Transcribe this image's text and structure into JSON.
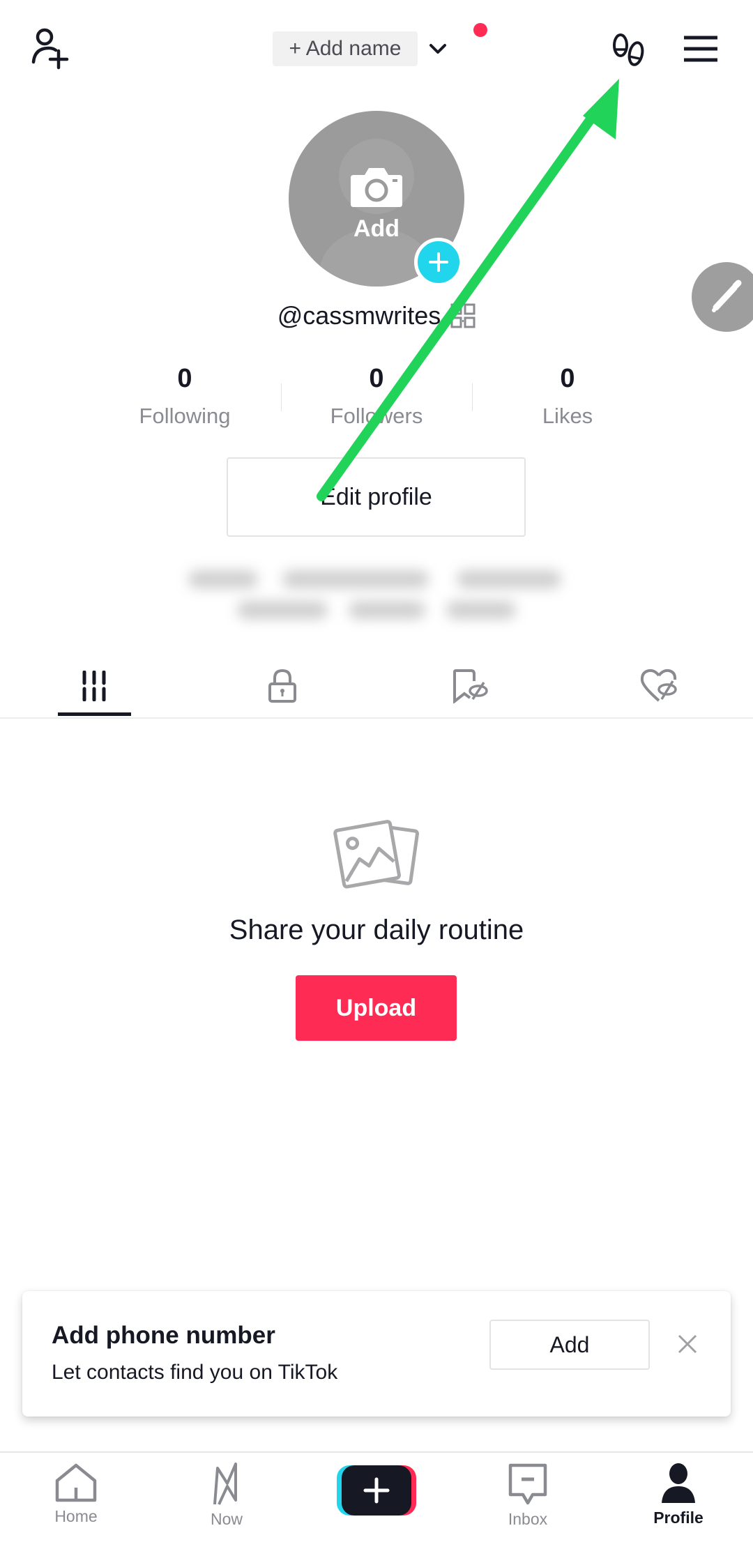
{
  "header": {
    "add_user_icon": "person-add-icon",
    "name_chip_label": "+ Add name",
    "dropdown_icon": "chevron-down-icon",
    "notification_dot_color": "#fe2c55",
    "footprints_icon": "footprints-icon",
    "menu_icon": "hamburger-menu-icon"
  },
  "profile": {
    "avatar_add_label": "Add",
    "avatar_icon": "camera-icon",
    "badge_icon": "plus-icon",
    "username": "@cassmwrites",
    "qr_icon": "qr-code-icon",
    "edit_icon": "pencil-icon",
    "stats": [
      {
        "value": "0",
        "label": "Following"
      },
      {
        "value": "0",
        "label": "Followers"
      },
      {
        "value": "0",
        "label": "Likes"
      }
    ],
    "edit_profile_label": "Edit profile",
    "bio_blurred": true
  },
  "tabs": [
    {
      "name": "videos",
      "icon": "grid-icon",
      "active": true
    },
    {
      "name": "private",
      "icon": "lock-icon",
      "active": false
    },
    {
      "name": "favorites",
      "icon": "bookmark-hidden-icon",
      "active": false
    },
    {
      "name": "liked",
      "icon": "heart-hidden-icon",
      "active": false
    }
  ],
  "empty_state": {
    "icon": "photos-icon",
    "title": "Share your daily routine",
    "upload_label": "Upload"
  },
  "phone_prompt": {
    "title": "Add phone number",
    "subtitle": "Let contacts find you on TikTok",
    "add_label": "Add",
    "close_icon": "close-icon"
  },
  "bottom_nav": [
    {
      "label": "Home",
      "icon": "home-icon",
      "active": false
    },
    {
      "label": "Now",
      "icon": "now-icon",
      "active": false
    },
    {
      "label": "",
      "icon": "create-plus-icon",
      "active": false
    },
    {
      "label": "Inbox",
      "icon": "inbox-icon",
      "active": false
    },
    {
      "label": "Profile",
      "icon": "profile-icon",
      "active": true
    }
  ],
  "colors": {
    "accent": "#fe2c55",
    "cyan": "#20d5ec",
    "text": "#161823",
    "muted": "#8a8b91",
    "annotation_arrow": "#22d35a"
  }
}
